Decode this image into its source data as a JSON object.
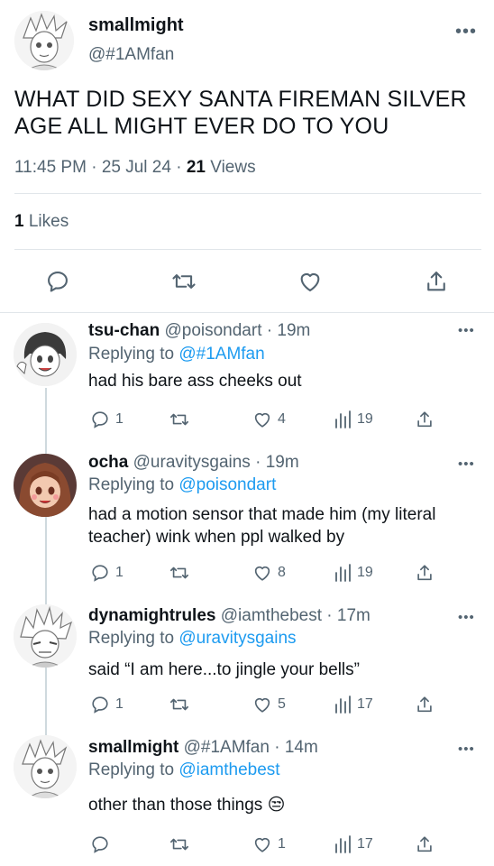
{
  "main_tweet": {
    "author_name": "smallmight",
    "author_handle": "@#1AMfan",
    "text": "WHAT DID SEXY SANTA FIREMAN SILVER AGE ALL MIGHT EVER DO TO YOU",
    "time": "11:45 PM",
    "sep1": "·",
    "date": "25 Jul 24",
    "sep2": "·",
    "views_count": "21",
    "views_label": "Views",
    "likes_count": "1",
    "likes_label": "Likes",
    "more_glyph": "•••"
  },
  "actions": {
    "reply_icon": "reply-icon",
    "retweet_icon": "retweet-icon",
    "like_icon": "like-icon",
    "share_icon": "share-icon"
  },
  "replies": [
    {
      "name": "tsu-chan",
      "handle": "@poisondart",
      "age": "· 19m",
      "replying_label": "Replying to",
      "replying_to": "@#1AMfan",
      "text": "had his bare ass cheeks out",
      "replies": "1",
      "likes": "4",
      "views": "19"
    },
    {
      "name": "ocha",
      "handle": "@uravitysgains",
      "age": "· 19m",
      "replying_label": "Replying to",
      "replying_to": "@poisondart",
      "text": "had a motion sensor that made him (my literal teacher) wink when ppl walked by",
      "replies": "1",
      "likes": "8",
      "views": "19"
    },
    {
      "name": "dynamightrules",
      "handle": "@iamthebest",
      "age": "· 17m",
      "replying_label": "Replying to",
      "replying_to": "@uravitysgains",
      "text": "said “I am here...to jingle your bells”",
      "replies": "1",
      "likes": "5",
      "views": "17"
    },
    {
      "name": "smallmight",
      "handle": "@#1AMfan",
      "age": "· 14m",
      "replying_label": "Replying to",
      "replying_to": "@iamthebest",
      "text": "other than those things 😒",
      "replies": "",
      "likes": "1",
      "views": "17"
    }
  ],
  "colors": {
    "text": "#0f1419",
    "secondary": "#536471",
    "link": "#1d9bf0",
    "divider": "#e1e6ea"
  }
}
